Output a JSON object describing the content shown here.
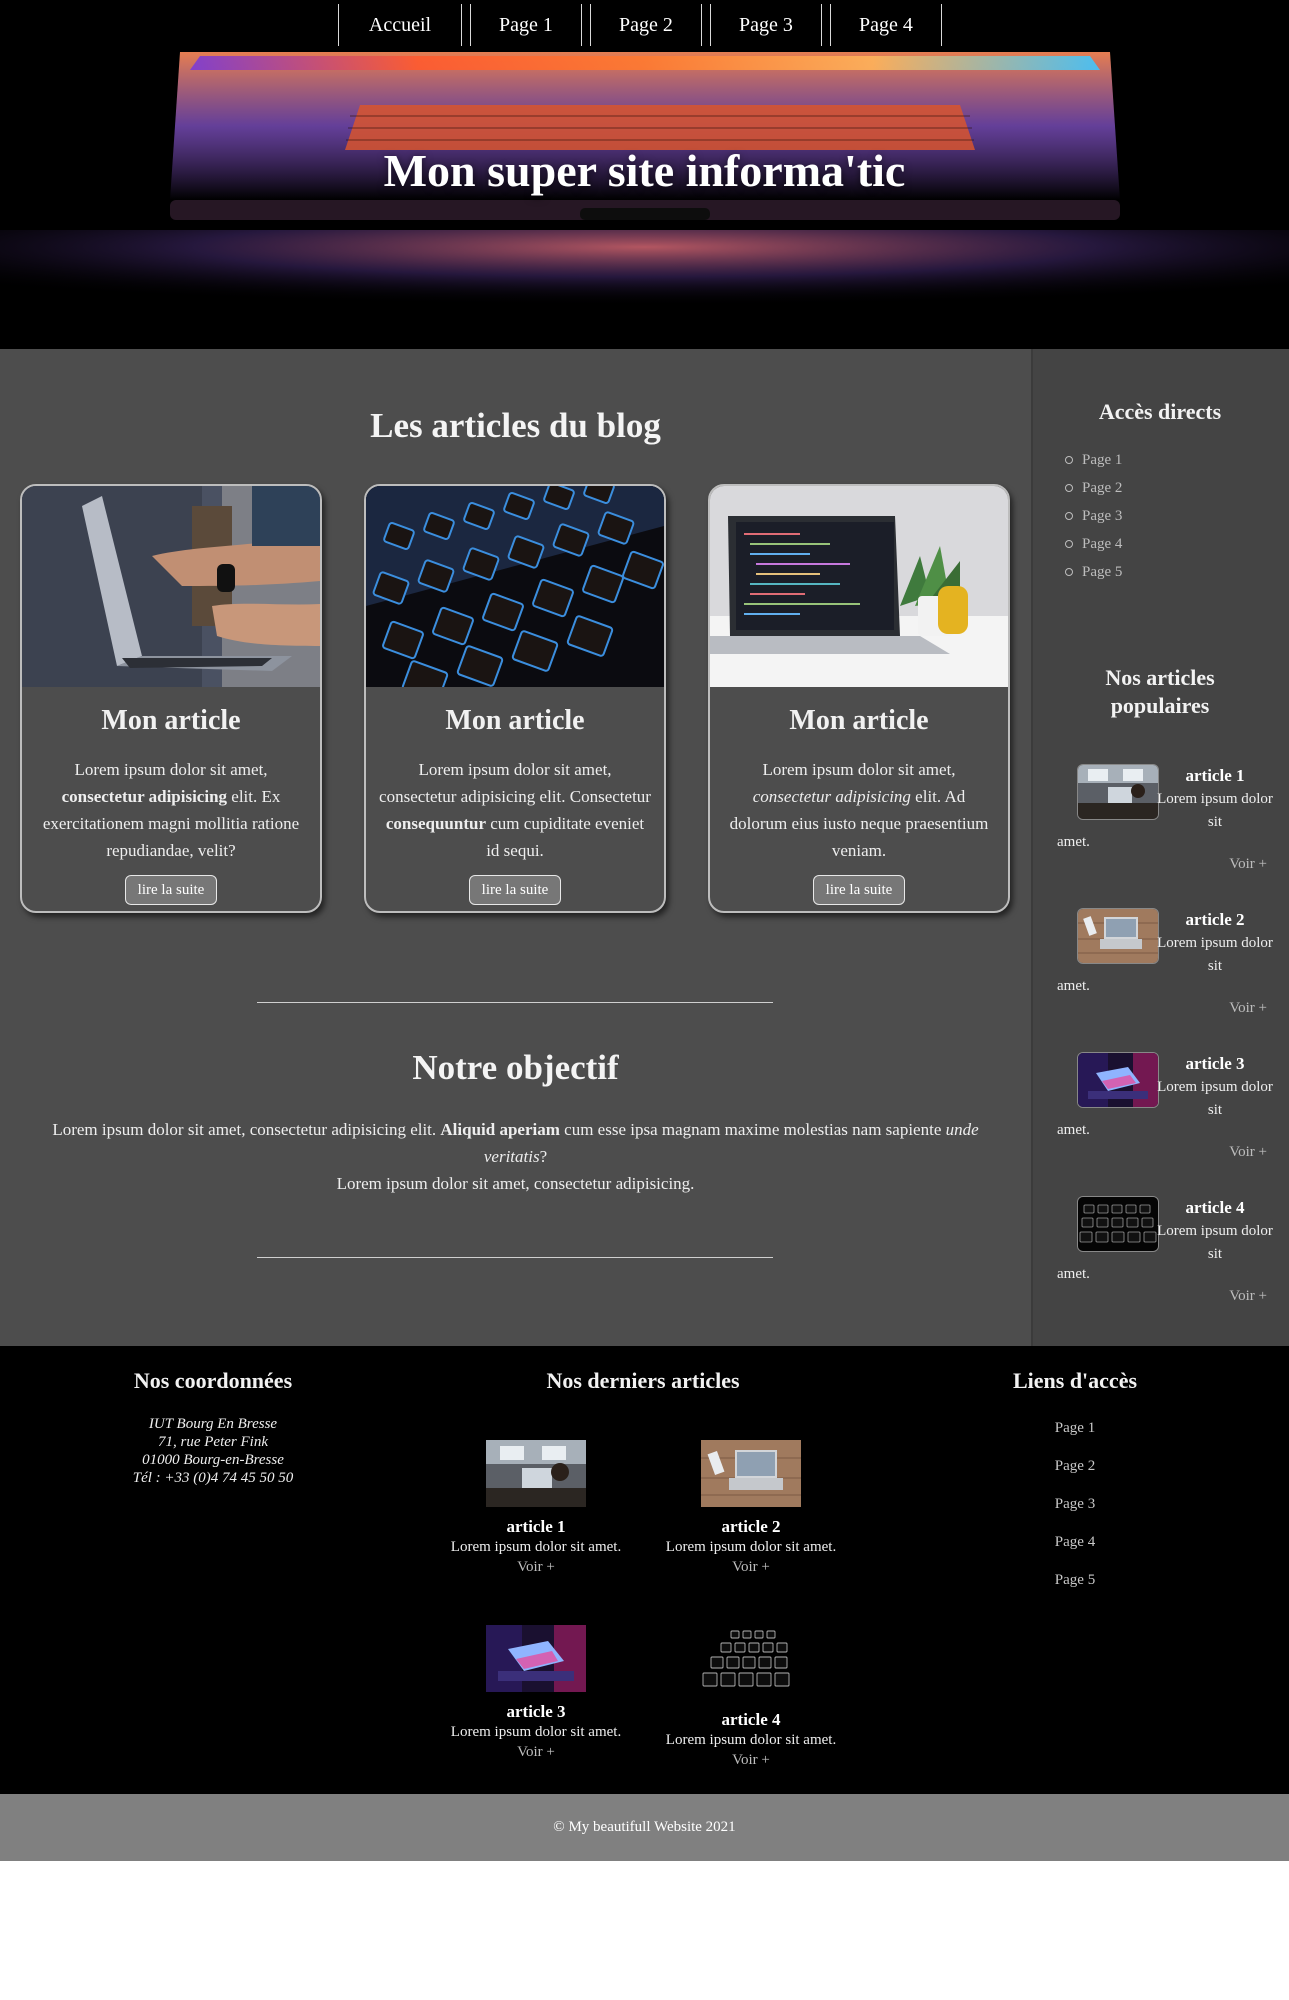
{
  "nav": {
    "items": [
      {
        "label": "Accueil"
      },
      {
        "label": "Page 1"
      },
      {
        "label": "Page 2"
      },
      {
        "label": "Page 3"
      },
      {
        "label": "Page 4"
      }
    ]
  },
  "hero": {
    "title": "Mon super site informa'tic"
  },
  "blog": {
    "title": "Les articles du blog",
    "read_more": "lire la suite",
    "cards": [
      {
        "title": "Mon article",
        "image": "laptop-typing-photo"
      },
      {
        "title": "Mon article",
        "image": "backlit-keyboard-photo"
      },
      {
        "title": "Mon article",
        "image": "laptop-on-desk-photo"
      }
    ],
    "card1": {
      "t1": "Lorem ipsum dolor sit amet,",
      "b": "consectetur adipisicing",
      "t2": " elit. Ex exercitationem magni mollitia ratione repudiandae, velit?"
    },
    "card2": {
      "t1": "Lorem ipsum dolor sit amet, consectetur adipisicing elit. Consectetur ",
      "b": "consequuntur",
      "t2": " cum cupiditate eveniet id sequi."
    },
    "card3": {
      "t1": "Lorem ipsum dolor sit amet, ",
      "i": "consectetur adipisicing",
      "t2": " elit. Ad dolorum eius iusto neque praesentium veniam."
    }
  },
  "objective": {
    "title": "Notre objectif",
    "t1": "Lorem ipsum dolor sit amet, consectetur adipisicing elit. ",
    "b": "Aliquid aperiam",
    "t2": " cum esse ipsa magnam maxime molestias nam sapiente ",
    "i": "unde veritatis",
    "t3": "?",
    "line2": "Lorem ipsum dolor sit amet, consectetur adipisicing."
  },
  "sidebar": {
    "direct_title": "Accès directs",
    "direct_links": [
      "Page 1",
      "Page 2",
      "Page 3",
      "Page 4",
      "Page 5"
    ],
    "popular_title": "Nos articles populaires",
    "popular": [
      {
        "title": "article 1",
        "text_a": "Lorem ipsum dolor sit",
        "text_b": "amet.",
        "more": "Voir +",
        "image": "desk-workspace-photo"
      },
      {
        "title": "article 2",
        "text_a": "Lorem ipsum dolor sit",
        "text_b": "amet.",
        "more": "Voir +",
        "image": "laptop-wood-table-photo"
      },
      {
        "title": "article 3",
        "text_a": "Lorem ipsum dolor sit",
        "text_b": "amet.",
        "more": "Voir +",
        "image": "neon-keyboard-photo"
      },
      {
        "title": "article 4",
        "text_a": "Lorem ipsum dolor sit",
        "text_b": "amet.",
        "more": "Voir +",
        "image": "dark-keyboard-photo"
      }
    ]
  },
  "footer": {
    "contact_title": "Nos coordonnées",
    "address": [
      "IUT Bourg En Bresse",
      "71, rue Peter Fink",
      "01000 Bourg-en-Bresse",
      "Tél : +33 (0)4 74 45 50 50"
    ],
    "latest_title": "Nos derniers articles",
    "latest": [
      {
        "title": "article 1",
        "text": "Lorem ipsum dolor sit amet.",
        "more": "Voir +"
      },
      {
        "title": "article 2",
        "text": "Lorem ipsum dolor sit amet.",
        "more": "Voir +"
      },
      {
        "title": "article 3",
        "text": "Lorem ipsum dolor sit amet.",
        "more": "Voir +"
      },
      {
        "title": "article 4",
        "text": "Lorem ipsum dolor sit amet.",
        "more": "Voir +"
      }
    ],
    "links_title": "Liens d'accès",
    "links": [
      "Page 1",
      "Page 2",
      "Page 3",
      "Page 4",
      "Page 5"
    ],
    "copyright": "© My beautifull Website 2021"
  },
  "colors": {
    "main_bg": "#4d4d4d",
    "sidebar_bg": "#444444",
    "footer_bg": "#000000",
    "copyright_bg": "#808080"
  }
}
